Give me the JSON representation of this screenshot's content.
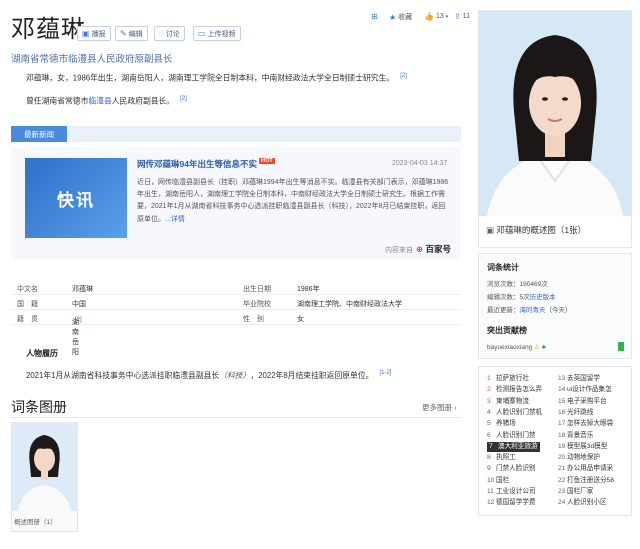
{
  "header": {
    "title": "邓蕴琳",
    "buttons": [
      {
        "icon": "video-icon",
        "label": "播报"
      },
      {
        "icon": "edit-icon",
        "label": "编辑"
      },
      {
        "icon": "discuss-icon",
        "label": "讨论"
      },
      {
        "icon": "upload-icon",
        "label": "上传视频"
      }
    ],
    "subtitle": "湖南省常德市临澧县人民政府原副县长"
  },
  "top_actions": [
    {
      "icon": "plus-square-icon",
      "label": ""
    },
    {
      "icon": "star-icon",
      "label": "收藏"
    },
    {
      "icon": "thumbs-up-icon",
      "label": "13"
    },
    {
      "icon": "share-icon",
      "label": "11"
    }
  ],
  "intro": {
    "line1": "邓蕴琳，女，1986年出生，湖南岳阳人，湖南理工学院全日制本科，中南财经政法大学全日制硕士研究生。",
    "line1_ref": "[2]",
    "line2_pre": "曾任湖南省常德市",
    "line2_link": "临澧县",
    "line2_post": "人民政府副县长。",
    "line2_ref": "[2]"
  },
  "news": {
    "tab_label": "最新新闻",
    "image_text": "快讯",
    "headline": "网传邓蕴琳94年出生等信息不实",
    "hot_badge": "HOT",
    "date": "2023-04-03 14:37",
    "body": "近日，网传临澧县副县长（挂职）邓蕴琳1994年出生等消息不实。临澧县有关部门表示，邓蕴琳1986年出生，湖南岳阳人，湖南理工学院全日制本科，中南财经政法大学全日制硕士研究生。根据工作需要，2021年1月从湖南省科技事务中心选派挂职临澧县副县长（科技），2022年8月已结束挂职，返回原单位。",
    "more": "...详情",
    "source_label": "内容来自",
    "source_brand": "百家号"
  },
  "info": {
    "rows": [
      {
        "l1": "中文名",
        "v1": "邓蕴琳",
        "l2": "出生日期",
        "v2": "1986年"
      },
      {
        "l1": "国　籍",
        "v1": "中国",
        "l2": "毕业院校",
        "v2": "湖南理工学院、中南财经政法大学"
      },
      {
        "l1": "籍　贯",
        "v1": "湖南岳阳",
        "v1_ref": "[2]",
        "l2": "性　别",
        "v2": "女"
      }
    ]
  },
  "career": {
    "heading": "人物履历",
    "text_pre": "2021年1月从湖南省科技事务中心选派挂职临澧县副县长",
    "text_italic": "（科技）",
    "text_post": "，2022年8月结束挂职返回原单位。",
    "ref": "[1-2]"
  },
  "album": {
    "title": "词条图册",
    "more": "更多图册 ›",
    "caption": "概述图册（1）"
  },
  "sidebar": {
    "photo_caption": "邓蕴琳的概述图（1张）",
    "stats_title": "词条统计",
    "views": "浏览次数：190469次",
    "edits_pre": "编辑次数：5次",
    "edits_link": "历史版本",
    "updated": "最近更新：",
    "updated_link": "海的青天",
    "updated_post": "（今天）",
    "contrib_title": "突出贡献榜",
    "contrib_user": "bayuexiaoxiang",
    "rank": [
      {
        "n": "1",
        "t": "拉萨旅行社"
      },
      {
        "n": "2",
        "t": "检测报告怎么弄"
      },
      {
        "n": "3",
        "t": "柬埔寨物流"
      },
      {
        "n": "4",
        "t": "人脸识别门禁机"
      },
      {
        "n": "5",
        "t": "养猪场"
      },
      {
        "n": "6",
        "t": "人脸识别门禁"
      },
      {
        "n": "7",
        "t": "澳大利亚旅游"
      },
      {
        "n": "8",
        "t": "执照工"
      },
      {
        "n": "9",
        "t": "门禁人脸识别"
      },
      {
        "n": "10",
        "t": "国栏"
      },
      {
        "n": "11",
        "t": "工业设计公司"
      },
      {
        "n": "12",
        "t": "德国留学学费"
      },
      {
        "n": "13",
        "t": "去英国留学"
      },
      {
        "n": "14",
        "t": "ui设计作品集怎"
      },
      {
        "n": "15",
        "t": "电子采购平台"
      },
      {
        "n": "16",
        "t": "光纤跳线"
      },
      {
        "n": "17",
        "t": "怎样去掉大眼袋"
      },
      {
        "n": "18",
        "t": "背景音乐"
      },
      {
        "n": "19",
        "t": "模型展3d模型"
      },
      {
        "n": "20",
        "t": "动物地保护"
      },
      {
        "n": "21",
        "t": "办公用品申请采"
      },
      {
        "n": "22",
        "t": "打鱼注册送分58"
      },
      {
        "n": "23",
        "t": "国栏厂家"
      },
      {
        "n": "24",
        "t": "人脸识别小区"
      }
    ]
  },
  "colors": {
    "accent": "#3b7bd6",
    "hot": "#f04a2c",
    "tab": "#4a8bdb"
  }
}
